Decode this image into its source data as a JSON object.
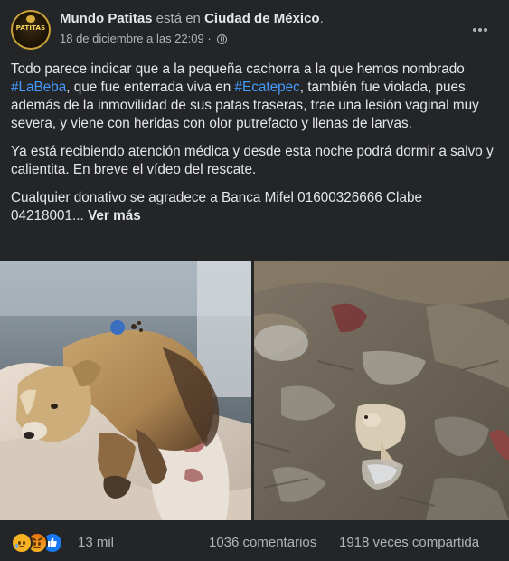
{
  "post": {
    "author": "Mundo Patitas",
    "location_prefix": " está en ",
    "location": "Ciudad de México",
    "location_suffix": ".",
    "date": "18 de diciembre a las 22:09 · ",
    "avatar_text": "PATITAS",
    "paragraph1": {
      "part1": "Todo parece indicar que a la pequeña cachorra a la que hemos nombrado ",
      "hashtag1": "#LaBeba",
      "part2": ", que fue enterrada viva en ",
      "hashtag2": "#Ecatepec",
      "part3": ", también fue violada, pues además de la inmovilidad de sus patas traseras, trae una lesión vaginal muy severa, y viene con heridas con olor putrefacto y llenas de larvas."
    },
    "paragraph2": "Ya está recibiendo atención médica y desde esta noche podrá dormir a salvo y calientita. En breve el vídeo del rescate.",
    "paragraph3": "Cualquier donativo se agradece a Banca Mifel 01600326666 Clabe 04218001... ",
    "see_more": "Ver más",
    "reactions": [
      "sad",
      "angry",
      "like"
    ],
    "reaction_count": "13 mil",
    "comments": "1036 comentarios",
    "shares": "1918 veces compartida"
  },
  "colors": {
    "background": "#242526",
    "text": "#e4e6eb",
    "secondary_text": "#b0b3b8",
    "hashtag": "#4599ff",
    "like_blue": "#1877f2",
    "sad_yellow": "#f7b125"
  },
  "icons": [
    "globe-icon",
    "more-options-icon",
    "sad-reaction-icon",
    "angry-reaction-icon",
    "like-reaction-icon"
  ]
}
